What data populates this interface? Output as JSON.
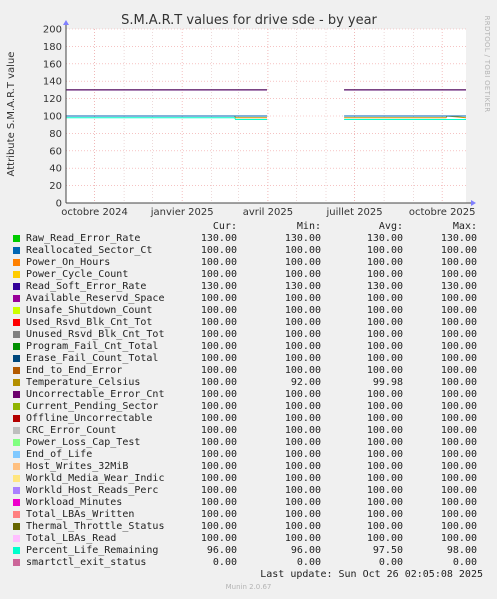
{
  "chart_data": {
    "type": "line",
    "title": "S.M.A.R.T values for drive sde - by year",
    "ylabel": "Attribute S.M.A.R.T value",
    "ylim": [
      0,
      200
    ],
    "yticks": [
      "0",
      "20",
      "40",
      "60",
      "80",
      "100",
      "120",
      "140",
      "160",
      "180",
      "200"
    ],
    "xlim": [
      "2024-09-01",
      "2025-10-26"
    ],
    "xticks": [
      {
        "date": "2024-10-01",
        "label": "octobre 2024"
      },
      {
        "date": "2025-01-01",
        "label": "janvier 2025"
      },
      {
        "date": "2025-04-01",
        "label": "avril 2025"
      },
      {
        "date": "2025-07-01",
        "label": "juillet 2025"
      },
      {
        "date": "2025-10-01",
        "label": "octobre 2025"
      }
    ],
    "grid": true,
    "segments": [
      {
        "series": "Raw_Read_Error_Rate",
        "color": "#00cc00",
        "points": [
          [
            "2024-09-01",
            130
          ],
          [
            "2025-03-31",
            130
          ]
        ]
      },
      {
        "series": "Raw_Read_Error_Rate",
        "color": "#00cc00",
        "points": [
          [
            "2025-06-20",
            130
          ],
          [
            "2025-10-26",
            130
          ]
        ]
      },
      {
        "series": "Read_Soft_Error_Rate",
        "color": "#330099",
        "points": [
          [
            "2024-09-01",
            130
          ],
          [
            "2025-03-31",
            130
          ]
        ]
      },
      {
        "series": "Read_Soft_Error_Rate",
        "color": "#330099",
        "points": [
          [
            "2025-06-20",
            130
          ],
          [
            "2025-10-26",
            130
          ]
        ]
      },
      {
        "series": "Uncorrectable_Error_Cnt",
        "color": "#660066",
        "points": [
          [
            "2024-09-01",
            130
          ],
          [
            "2025-03-31",
            130
          ]
        ]
      },
      {
        "series": "Uncorrectable_Error_Cnt",
        "color": "#660066",
        "points": [
          [
            "2025-06-20",
            130
          ],
          [
            "2025-10-26",
            130
          ]
        ]
      },
      {
        "series": "Temperature_Celsius",
        "color": "#cc9900",
        "points": [
          [
            "2024-09-01",
            100
          ],
          [
            "2025-02-25",
            100
          ],
          [
            "2025-02-26",
            98
          ],
          [
            "2025-03-31",
            98
          ]
        ]
      },
      {
        "series": "Temperature_Celsius",
        "color": "#cc9900",
        "points": [
          [
            "2025-06-20",
            98
          ],
          [
            "2025-10-05",
            98
          ],
          [
            "2025-10-06",
            100
          ],
          [
            "2025-10-26",
            98
          ]
        ]
      },
      {
        "series": "Reallocated_Sector_Ct",
        "color": "#0066b3",
        "points": [
          [
            "2024-09-01",
            100
          ],
          [
            "2025-03-31",
            100
          ]
        ]
      },
      {
        "series": "Reallocated_Sector_Ct",
        "color": "#0066b3",
        "points": [
          [
            "2025-06-20",
            100
          ],
          [
            "2025-10-26",
            100
          ]
        ]
      },
      {
        "series": "Percent_Life_Remaining",
        "color": "#00ffcc",
        "points": [
          [
            "2024-09-01",
            98
          ],
          [
            "2025-02-25",
            98
          ],
          [
            "2025-02-26",
            96
          ],
          [
            "2025-03-31",
            96
          ]
        ]
      },
      {
        "series": "Percent_Life_Remaining",
        "color": "#00ffcc",
        "points": [
          [
            "2025-06-20",
            96
          ],
          [
            "2025-10-26",
            96
          ]
        ]
      },
      {
        "series": "smartctl_exit_status",
        "color": "#cc6699",
        "points": [
          [
            "2024-09-01",
            0
          ],
          [
            "2025-03-31",
            0
          ]
        ]
      },
      {
        "series": "smartctl_exit_status",
        "color": "#cc6699",
        "points": [
          [
            "2025-06-20",
            0
          ],
          [
            "2025-10-26",
            0
          ]
        ]
      }
    ],
    "side_label": "RRDTOOL / TOBI OETIKER",
    "series": [
      {
        "name": "Raw_Read_Error_Rate",
        "color": "#00cc00",
        "cur": "130.00",
        "min": "130.00",
        "avg": "130.00",
        "max": "130.00"
      },
      {
        "name": "Reallocated_Sector_Ct",
        "color": "#0066b3",
        "cur": "100.00",
        "min": "100.00",
        "avg": "100.00",
        "max": "100.00"
      },
      {
        "name": "Power_On_Hours",
        "color": "#ff8000",
        "cur": "100.00",
        "min": "100.00",
        "avg": "100.00",
        "max": "100.00"
      },
      {
        "name": "Power_Cycle_Count",
        "color": "#ffcc00",
        "cur": "100.00",
        "min": "100.00",
        "avg": "100.00",
        "max": "100.00"
      },
      {
        "name": "Read_Soft_Error_Rate",
        "color": "#330099",
        "cur": "130.00",
        "min": "130.00",
        "avg": "130.00",
        "max": "130.00"
      },
      {
        "name": "Available_Reservd_Space",
        "color": "#990099",
        "cur": "100.00",
        "min": "100.00",
        "avg": "100.00",
        "max": "100.00"
      },
      {
        "name": "Unsafe_Shutdown_Count",
        "color": "#ccff00",
        "cur": "100.00",
        "min": "100.00",
        "avg": "100.00",
        "max": "100.00"
      },
      {
        "name": "Used_Rsvd_Blk_Cnt_Tot",
        "color": "#ff0000",
        "cur": "100.00",
        "min": "100.00",
        "avg": "100.00",
        "max": "100.00"
      },
      {
        "name": "Unused_Rsvd_Blk_Cnt_Tot",
        "color": "#808080",
        "cur": "100.00",
        "min": "100.00",
        "avg": "100.00",
        "max": "100.00"
      },
      {
        "name": "Program_Fail_Cnt_Total",
        "color": "#008f00",
        "cur": "100.00",
        "min": "100.00",
        "avg": "100.00",
        "max": "100.00"
      },
      {
        "name": "Erase_Fail_Count_Total",
        "color": "#00487d",
        "cur": "100.00",
        "min": "100.00",
        "avg": "100.00",
        "max": "100.00"
      },
      {
        "name": "End_to_End_Error",
        "color": "#b35a00",
        "cur": "100.00",
        "min": "100.00",
        "avg": "100.00",
        "max": "100.00"
      },
      {
        "name": "Temperature_Celsius",
        "color": "#b38f00",
        "cur": "100.00",
        "min": "92.00",
        "avg": "99.98",
        "max": "100.00"
      },
      {
        "name": "Uncorrectable_Error_Cnt",
        "color": "#6b006b",
        "cur": "100.00",
        "min": "100.00",
        "avg": "100.00",
        "max": "100.00"
      },
      {
        "name": "Current_Pending_Sector",
        "color": "#8fb300",
        "cur": "100.00",
        "min": "100.00",
        "avg": "100.00",
        "max": "100.00"
      },
      {
        "name": "Offline_Uncorrectable",
        "color": "#b30000",
        "cur": "100.00",
        "min": "100.00",
        "avg": "100.00",
        "max": "100.00"
      },
      {
        "name": "CRC_Error_Count",
        "color": "#bebebe",
        "cur": "100.00",
        "min": "100.00",
        "avg": "100.00",
        "max": "100.00"
      },
      {
        "name": "Power_Loss_Cap_Test",
        "color": "#80ff80",
        "cur": "100.00",
        "min": "100.00",
        "avg": "100.00",
        "max": "100.00"
      },
      {
        "name": "End_of_Life",
        "color": "#80c9ff",
        "cur": "100.00",
        "min": "100.00",
        "avg": "100.00",
        "max": "100.00"
      },
      {
        "name": "Host_Writes_32MiB",
        "color": "#ffc080",
        "cur": "100.00",
        "min": "100.00",
        "avg": "100.00",
        "max": "100.00"
      },
      {
        "name": "Workld_Media_Wear_Indic",
        "color": "#ffe680",
        "cur": "100.00",
        "min": "100.00",
        "avg": "100.00",
        "max": "100.00"
      },
      {
        "name": "Workld_Host_Reads_Perc",
        "color": "#aa80ff",
        "cur": "100.00",
        "min": "100.00",
        "avg": "100.00",
        "max": "100.00"
      },
      {
        "name": "Workload_Minutes",
        "color": "#ee00cc",
        "cur": "100.00",
        "min": "100.00",
        "avg": "100.00",
        "max": "100.00"
      },
      {
        "name": "Total_LBAs_Written",
        "color": "#ff8080",
        "cur": "100.00",
        "min": "100.00",
        "avg": "100.00",
        "max": "100.00"
      },
      {
        "name": "Thermal_Throttle_Status",
        "color": "#666600",
        "cur": "100.00",
        "min": "100.00",
        "avg": "100.00",
        "max": "100.00"
      },
      {
        "name": "Total_LBAs_Read",
        "color": "#ffbfff",
        "cur": "100.00",
        "min": "100.00",
        "avg": "100.00",
        "max": "100.00"
      },
      {
        "name": "Percent_Life_Remaining",
        "color": "#00ffcc",
        "cur": "96.00",
        "min": "96.00",
        "avg": "97.50",
        "max": "98.00"
      },
      {
        "name": "smartctl_exit_status",
        "color": "#cc6699",
        "cur": "0.00",
        "min": "0.00",
        "avg": "0.00",
        "max": "0.00"
      }
    ]
  },
  "legend": {
    "col_cur": "Cur:",
    "col_min": "Min:",
    "col_avg": "Avg:",
    "col_max": "Max:"
  },
  "last_update": "Last update: Sun Oct 26 02:05:08 2025",
  "footer": "Munin 2.0.67"
}
